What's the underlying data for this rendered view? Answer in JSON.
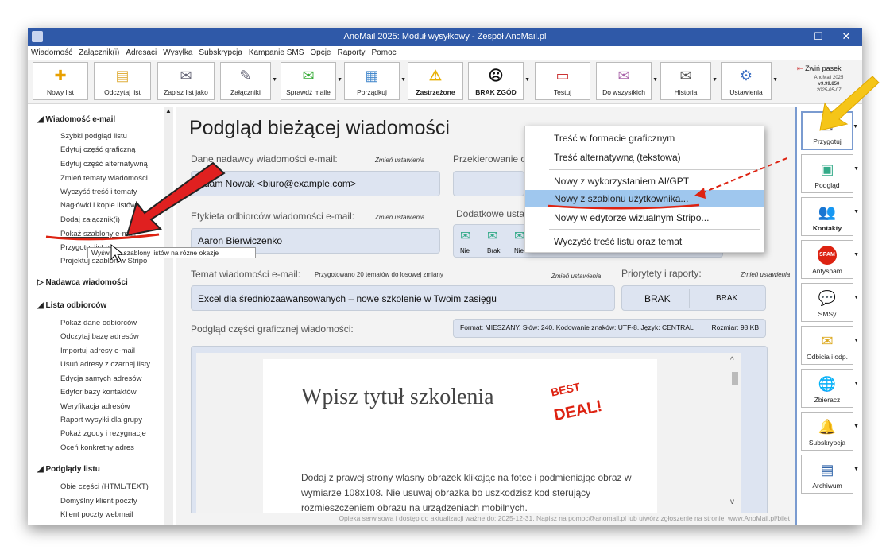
{
  "window": {
    "title": "AnoMail 2025: Moduł wysyłkowy - Zespół AnoMail.pl",
    "minimize": "—",
    "maximize": "☐",
    "close": "✕"
  },
  "menu": [
    "Wiadomość",
    "Załącznik(i)",
    "Adresaci",
    "Wysyłka",
    "Subskrypcja",
    "Kampanie SMS",
    "Opcje",
    "Raporty",
    "Pomoc"
  ],
  "toolbar": {
    "new_mail": "Nowy list",
    "read_mail": "Odczytaj list",
    "save_as": "Zapisz list jako",
    "attachments": "Załączniki",
    "check_mails": "Sprawdź maile",
    "organize": "Porządkuj",
    "reserved": "Zastrzeżone",
    "no_consent": "BRAK ZGÓD",
    "test": "Testuj",
    "to_all": "Do wszystkich",
    "history": "Historia",
    "settings": "Ustawienia",
    "collapse": "Zwiń pasek",
    "app_name": "AnoMail 2025",
    "version": "v9.99.850",
    "date": "2025-05-07"
  },
  "sidebar": {
    "s1": "Wiadomość e-mail",
    "s1_items": [
      "Szybki podgląd listu",
      "Edytuj część graficzną",
      "Edytuj część alternatywną",
      "Zmień tematy wiadomości",
      "Wyczyść treść i tematy",
      "Nagłówki i kopie listów",
      "Dodaj załącznik(i)",
      "Pokaż szablony e-mail",
      "Przygotuj list p",
      "Projektuj szablon w Stripo"
    ],
    "s2": "Nadawca wiadomości",
    "s3": "Lista odbiorców",
    "s3_items": [
      "Pokaż dane odbiorców",
      "Odczytaj bazę adresów",
      "Importuj adresy e-mail",
      "Usuń adresy z czarnej listy",
      "Edycja samych adresów",
      "Edytor bazy kontaktów",
      "Weryfikacja adresów",
      "Raport wysyłki dla grupy",
      "Pokaż zgody i rezygnacje",
      "Oceń konkretny adres"
    ],
    "s4": "Podglądy listu",
    "s4_items": [
      "Obie części (HTML/TEXT)",
      "Domyślny klient poczty",
      "Klient poczty webmail"
    ]
  },
  "tooltip": "Wyświetla szablony listów na różne okazje",
  "main": {
    "heading": "Podgląd bieżącej wiadomości",
    "sender_label": "Dane nadawcy wiadomości e-mail:",
    "change": "Zmień ustawienia",
    "sender_value": "Adam Nowak <biuro@example.com>",
    "redirect_label": "Przekierowanie o",
    "recipients_label": "Etykieta odbiorców wiadomości e-mail:",
    "recipients_value": "Aaron Bierwiczenko",
    "extra_label": "Dodatkowe usta",
    "extra_items": [
      "Nie",
      "Brak",
      "Nie",
      "Nie",
      "Nie",
      "Nie",
      "Nie",
      "Nie"
    ],
    "subject_label": "Temat wiadomości e-mail:",
    "subject_note": "Przygotowano 20 tematów do losowej zmiany",
    "subject_value": "Excel dla średniozaawansowanych – nowe szkolenie w Twoim zasięgu",
    "priority_label": "Priorytety i raporty:",
    "priority_a": "BRAK",
    "priority_b": "BRAK",
    "preview_label": "Podgląd części graficznej wiadomości:",
    "format_info": "Format: MIESZANY. Słów: 240. Kodowanie znaków: UTF-8. Język: CENTRAL",
    "size_info": "Rozmiar: 98 KB",
    "preview_title": "Wpisz tytuł szkolenia",
    "preview_text": "Dodaj z prawej strony własny obrazek klikając na fotce i podmieniając obraz w wymiarze 108x108. Nie usuwaj obrazka bo uszkodzisz kod sterujący rozmieszczeniem obrazu na urządzeniach mobilnych.",
    "badge_line1": "BEST",
    "badge_line2": "DEAL!"
  },
  "context_menu": [
    "Treść w formacie graficznym",
    "Treść alternatywną (tekstowa)",
    "Nowy z wykorzystaniem AI/GPT",
    "Nowy z szablonu użytkownika...",
    "Nowy w edytorze wizualnym Stripo...",
    "Wyczyść treść listu oraz temat"
  ],
  "right_panel": [
    "Przygotuj",
    "Podgląd",
    "Kontakty",
    "Antyspam",
    "SMSy",
    "Odbicia i odp.",
    "Zbieracz",
    "Subskrypcja",
    "Archiwum"
  ],
  "spam_icon": "SPAM",
  "status": "Opieka serwisowa i dostęp do aktualizacji ważne do: 2025-12-31. Napisz na pomoc@anomail.pl lub utwórz zgłoszenie na stronie: www.AnoMail.pl/bilet",
  "colors": {
    "titlebar": "#2f59a8",
    "highlight": "#9fc7ee",
    "accent_arrow": "#e02020",
    "arrow_yellow": "#f5c518"
  }
}
